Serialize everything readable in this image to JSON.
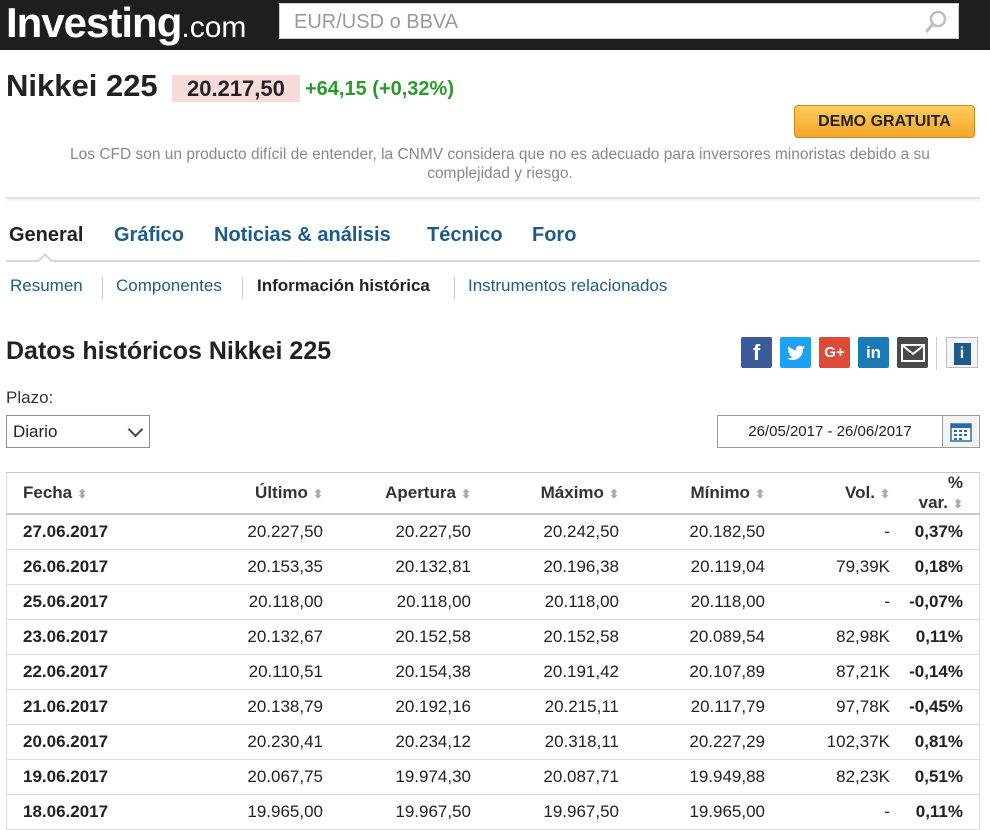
{
  "header": {
    "logo_main": "Investing",
    "logo_suffix": ".com",
    "search_placeholder": "EUR/USD o BBVA"
  },
  "instrument": {
    "name": "Nikkei 225",
    "price": "20.217,50",
    "change": "+64,15 (+0,32%)"
  },
  "cta": {
    "demo_label": "DEMO GRATUITA",
    "disclaimer": "Los CFD son un producto difícil de entender, la CNMV considera que no es adecuado para inversores minoristas debido a su complejidad y riesgo."
  },
  "tabs": [
    "General",
    "Gráfico",
    "Noticias & análisis",
    "Técnico",
    "Foro"
  ],
  "subnav": [
    "Resumen",
    "Componentes",
    "Información histórica",
    "Instrumentos relacionados"
  ],
  "section": {
    "title": "Datos históricos Nikkei 225",
    "share_icons": {
      "facebook": "f",
      "twitter": "t",
      "google": "G+",
      "linkedin": "in",
      "mail": "✉",
      "info": "i"
    }
  },
  "filters": {
    "plazo_label": "Plazo:",
    "plazo_value": "Diario",
    "date_range": "26/05/2017 - 26/06/2017"
  },
  "table": {
    "columns": [
      "Fecha",
      "Último",
      "Apertura",
      "Máximo",
      "Mínimo",
      "Vol.",
      "% var."
    ],
    "rows": [
      {
        "fecha": "27.06.2017",
        "ultimo": "20.227,50",
        "apertura": "20.227,50",
        "maximo": "20.242,50",
        "minimo": "20.182,50",
        "vol": "-",
        "var": "0,37%",
        "dir": "up"
      },
      {
        "fecha": "26.06.2017",
        "ultimo": "20.153,35",
        "apertura": "20.132,81",
        "maximo": "20.196,38",
        "minimo": "20.119,04",
        "vol": "79,39K",
        "var": "0,18%",
        "dir": "up"
      },
      {
        "fecha": "25.06.2017",
        "ultimo": "20.118,00",
        "apertura": "20.118,00",
        "maximo": "20.118,00",
        "minimo": "20.118,00",
        "vol": "-",
        "var": "-0,07%",
        "dir": "down"
      },
      {
        "fecha": "23.06.2017",
        "ultimo": "20.132,67",
        "apertura": "20.152,58",
        "maximo": "20.152,58",
        "minimo": "20.089,54",
        "vol": "82,98K",
        "var": "0,11%",
        "dir": "up"
      },
      {
        "fecha": "22.06.2017",
        "ultimo": "20.110,51",
        "apertura": "20.154,38",
        "maximo": "20.191,42",
        "minimo": "20.107,89",
        "vol": "87,21K",
        "var": "-0,14%",
        "dir": "down"
      },
      {
        "fecha": "21.06.2017",
        "ultimo": "20.138,79",
        "apertura": "20.192,16",
        "maximo": "20.215,11",
        "minimo": "20.117,79",
        "vol": "97,78K",
        "var": "-0,45%",
        "dir": "down"
      },
      {
        "fecha": "20.06.2017",
        "ultimo": "20.230,41",
        "apertura": "20.234,12",
        "maximo": "20.318,11",
        "minimo": "20.227,29",
        "vol": "102,37K",
        "var": "0,81%",
        "dir": "up"
      },
      {
        "fecha": "19.06.2017",
        "ultimo": "20.067,75",
        "apertura": "19.974,30",
        "maximo": "20.087,71",
        "minimo": "19.949,88",
        "vol": "82,23K",
        "var": "0,51%",
        "dir": "up"
      },
      {
        "fecha": "18.06.2017",
        "ultimo": "19.965,00",
        "apertura": "19.967,50",
        "maximo": "19.967,50",
        "minimo": "19.965,00",
        "vol": "-",
        "var": "0,11%",
        "dir": "up"
      }
    ]
  },
  "colors": {
    "positive": "#2a9a2a",
    "negative": "#d0221e",
    "link": "#1e5b8a",
    "price_highlight": "#f7dada"
  }
}
